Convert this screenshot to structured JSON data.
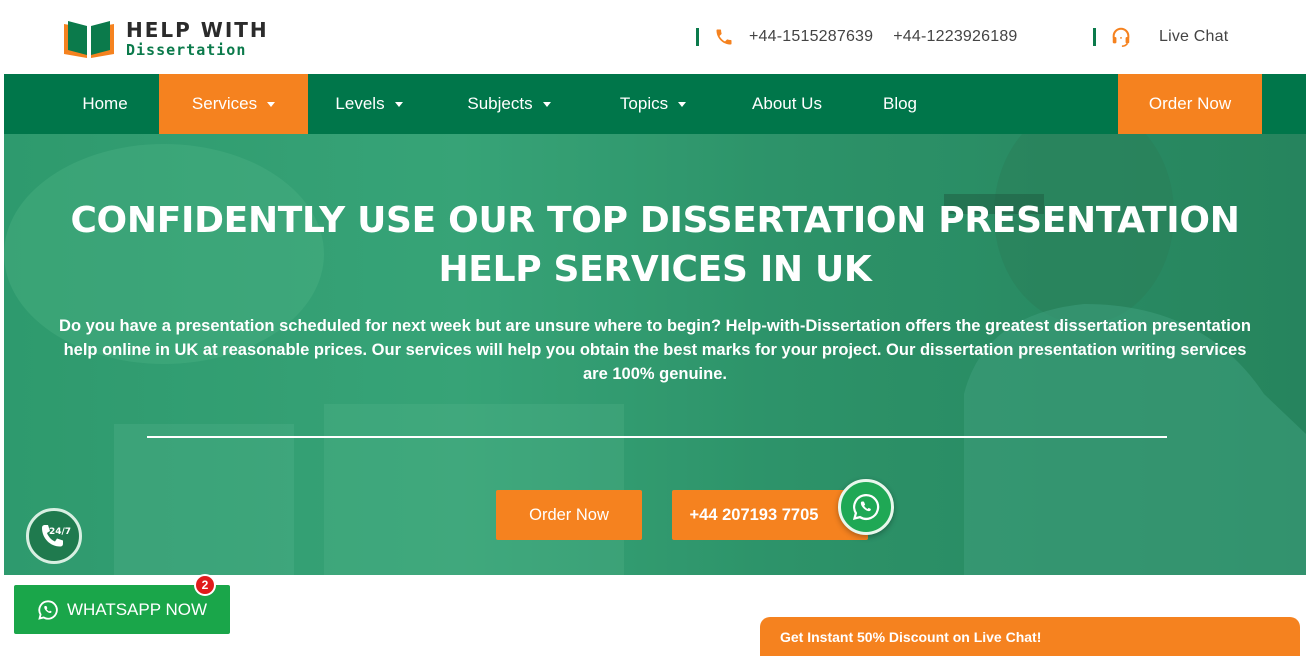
{
  "brand": {
    "line1": "HELP WITH",
    "line2": "Dissertation"
  },
  "header": {
    "phone1": "+44-1515287639",
    "phone2": "+44-1223926189",
    "live_chat": "Live Chat"
  },
  "nav": {
    "items": [
      {
        "label": "Home"
      },
      {
        "label": "Services"
      },
      {
        "label": "Levels"
      },
      {
        "label": "Subjects"
      },
      {
        "label": "Topics"
      },
      {
        "label": "About Us"
      },
      {
        "label": "Blog"
      }
    ],
    "order": "Order Now"
  },
  "hero": {
    "title_line1": "CONFIDENTLY USE OUR TOP DISSERTATION PRESENTATION",
    "title_line2": "HELP SERVICES IN UK",
    "subtitle": "Do you have a presentation scheduled for next week but are unsure where to begin? Help-with-Dissertation offers the greatest dissertation presentation help online in UK at reasonable prices. Our services will help you obtain the best marks for your project. Our dissertation presentation writing services are 100% genuine.",
    "order_button": "Order Now",
    "phone_button": "+44 207193 7705"
  },
  "floating": {
    "badge_247": "24/7",
    "whatsapp_label": "WHATSAPP NOW",
    "whatsapp_count": "2",
    "chat_bar": "Get Instant 50% Discount on Live Chat!"
  },
  "colors": {
    "green": "#00764a",
    "orange": "#f5821f",
    "whatsapp": "#1aa64a"
  }
}
